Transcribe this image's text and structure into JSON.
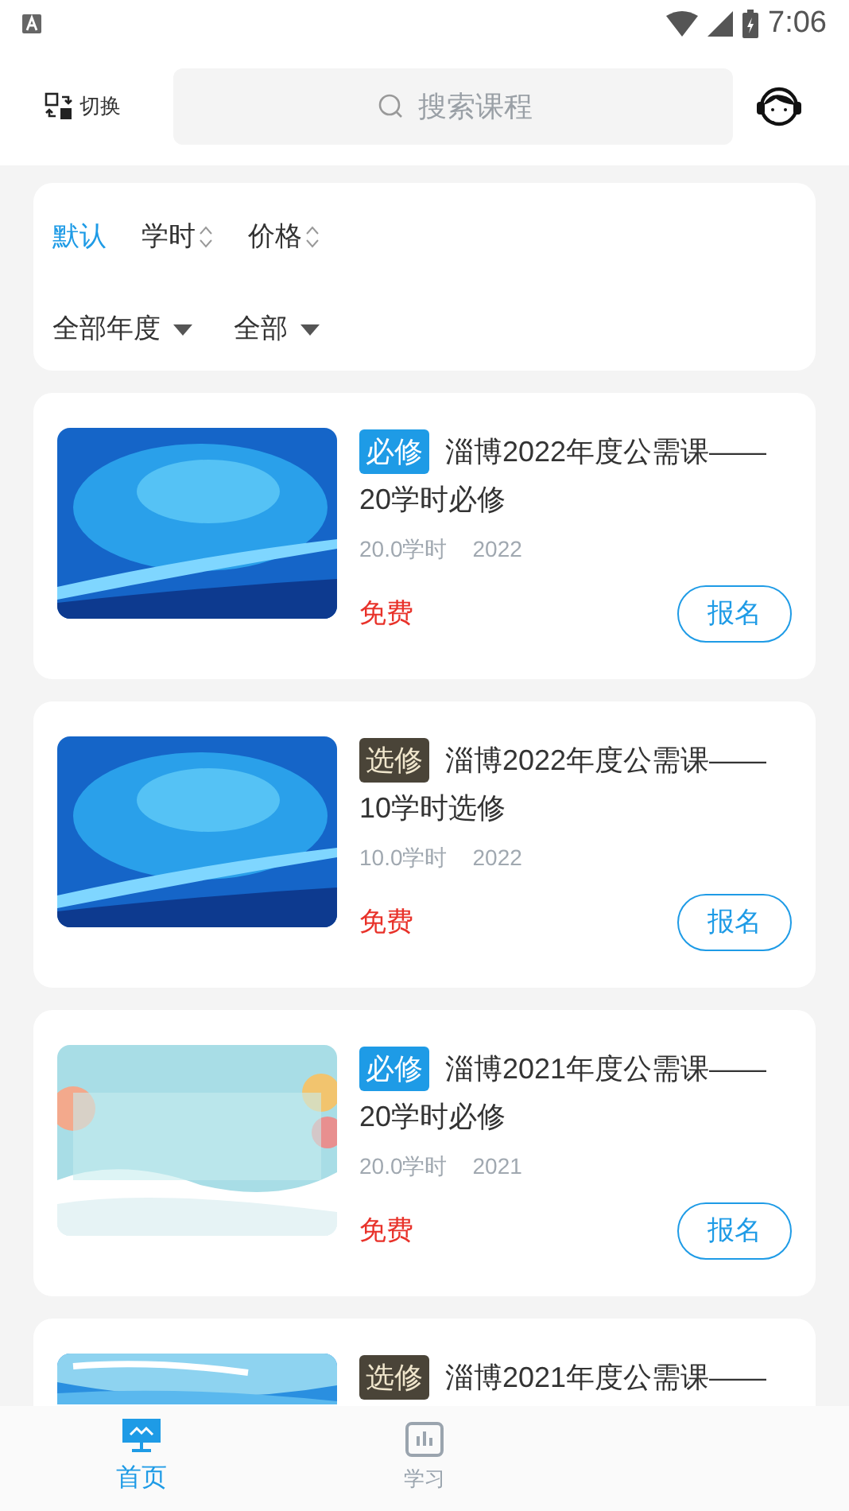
{
  "status_bar": {
    "time": "7:06"
  },
  "header": {
    "switch_label": "切换",
    "search": {
      "placeholder": "搜索课程"
    }
  },
  "sort_options": [
    {
      "label": "默认",
      "kind": "plain",
      "selected": true
    },
    {
      "label": "学时",
      "kind": "sortable",
      "selected": false
    },
    {
      "label": "价格",
      "kind": "sortable",
      "selected": false
    }
  ],
  "filters": [
    {
      "label": "全部年度"
    },
    {
      "label": "全部"
    }
  ],
  "courses": [
    {
      "tag": "必修",
      "color": "#1e9be6",
      "title_lines": [
        "淄博2022年度公需课——",
        "20学时必修"
      ],
      "hours": "20.0学时",
      "year": "2022",
      "price": "免费",
      "button": "报名"
    },
    {
      "tag": "选修",
      "color": "#4a4438",
      "title_lines": [
        "淄博2022年度公需课——",
        "10学时选修"
      ],
      "hours": "10.0学时",
      "year": "2022",
      "price": "免费",
      "button": "报名"
    },
    {
      "tag": "必修",
      "color": "#1e9be6",
      "title_lines": [
        "淄博2021年度公需课——",
        "20学时必修"
      ],
      "hours": "20.0学时",
      "year": "2021",
      "price": "免费",
      "button": "报名"
    },
    {
      "tag": "选修",
      "color": "#4a4438",
      "title_lines": [
        "淄博2021年度公需课——"
      ]
    }
  ],
  "bottom_nav": [
    {
      "label": "首页",
      "kind": "home",
      "selected": true
    },
    {
      "label": "学习",
      "kind": "study",
      "selected": false
    }
  ]
}
